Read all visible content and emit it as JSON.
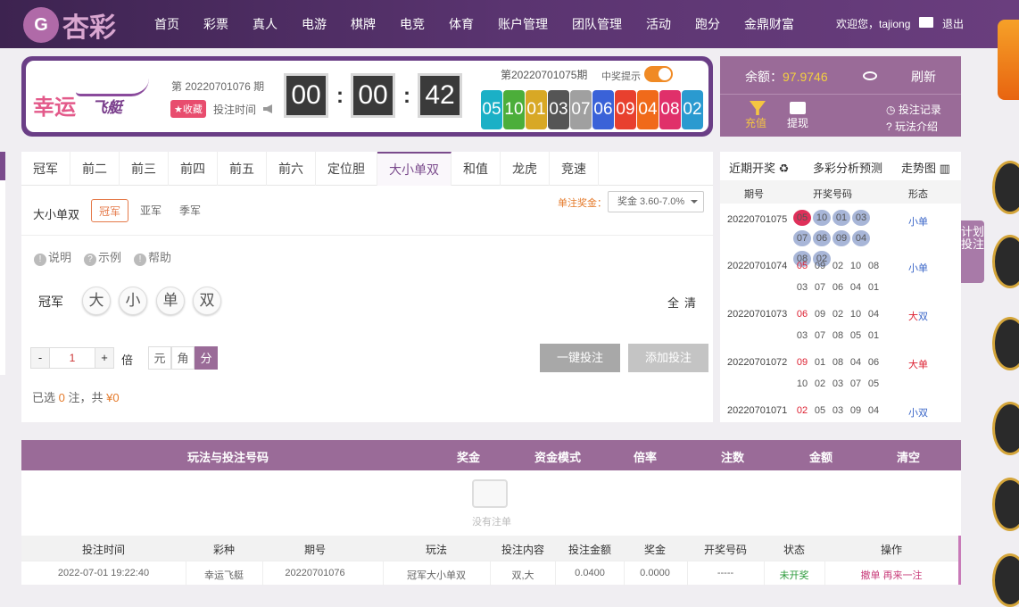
{
  "brand": {
    "name": "杏彩",
    "mark": "G"
  },
  "nav": [
    "首页",
    "彩票",
    "真人",
    "电游",
    "棋牌",
    "电竞",
    "体育",
    "账户管理",
    "团队管理",
    "活动",
    "跑分",
    "金鼎财富"
  ],
  "user": {
    "welcome": "欢迎您，tajiong",
    "logout": "退出"
  },
  "game": {
    "name_a": "幸运",
    "name_b": "飞艇",
    "issue": "第 20220701076 期",
    "fav": "★收藏",
    "bet_time_label": "投注时间",
    "countdown": [
      "00",
      "00",
      "42"
    ],
    "last_issue": "第20220701075期",
    "prize_tip": "中奖提示",
    "balls": [
      "05",
      "10",
      "01",
      "03",
      "07",
      "06",
      "09",
      "04",
      "08",
      "02"
    ],
    "ball_colors": [
      "#1bb0c6",
      "#4cae3a",
      "#d8a825",
      "#555555",
      "#a0a0a0",
      "#3a62d8",
      "#e8402e",
      "#f06a1a",
      "#e0306a",
      "#2a9ad0"
    ]
  },
  "account": {
    "balance_label": "余额：",
    "balance": "97.9746",
    "refresh": "刷新",
    "deposit": "充值",
    "withdraw": "提现",
    "bet_record": "投注记录",
    "rules": "玩法介绍"
  },
  "tabs": [
    "冠军",
    "前二",
    "前三",
    "前四",
    "前五",
    "前六",
    "定位胆",
    "大小单双",
    "和值",
    "龙虎",
    "竞速"
  ],
  "active_tab": "大小单双",
  "subplay": {
    "title": "大小单双",
    "options": [
      "冠军",
      "亚军",
      "季军"
    ],
    "bonus_label": "单注奖金：",
    "bonus_value": "奖金 3.60-7.0%"
  },
  "helps": [
    "说明",
    "示例",
    "帮助"
  ],
  "pick": {
    "label": "冠军",
    "options": [
      "大",
      "小",
      "单",
      "双"
    ],
    "all_clear": "全清"
  },
  "bet": {
    "multiplier": "1",
    "minus": "-",
    "plus": "+",
    "bei": "倍",
    "units": [
      "元",
      "角",
      "分"
    ],
    "active_unit": "分",
    "quick_bet": "一键投注",
    "add_bet": "添加投注",
    "summary_pre": "已选",
    "count": "0",
    "summary_mid": "注，共",
    "amount": "¥0"
  },
  "history": {
    "tabs": [
      "近期开奖",
      "多彩分析预测",
      "走势图"
    ],
    "headers": [
      "期号",
      "开奖号码",
      "形态"
    ],
    "rows": [
      {
        "issue": "20220701075",
        "nums": [
          "05",
          "10",
          "01",
          "03",
          "07",
          "06",
          "09",
          "04",
          "08",
          "02"
        ],
        "shape_a": "",
        "shape_b": "小单"
      },
      {
        "issue": "20220701074",
        "nums": [
          "05",
          "09",
          "02",
          "10",
          "08",
          "03",
          "07",
          "06",
          "04",
          "01"
        ],
        "shape_a": "",
        "shape_b": "小单"
      },
      {
        "issue": "20220701073",
        "nums": [
          "06",
          "09",
          "02",
          "10",
          "04",
          "03",
          "07",
          "08",
          "05",
          "01"
        ],
        "shape_a": "大",
        "shape_b": "双"
      },
      {
        "issue": "20220701072",
        "nums": [
          "09",
          "01",
          "08",
          "04",
          "06",
          "10",
          "02",
          "03",
          "07",
          "05"
        ],
        "shape_a": "大单",
        "shape_b": ""
      },
      {
        "issue": "20220701071",
        "nums": [
          "02",
          "05",
          "03",
          "09",
          "04"
        ],
        "shape_a": "",
        "shape_b": "小双"
      }
    ]
  },
  "plan": "计划投注",
  "betlist": {
    "headers": [
      "玩法与投注号码",
      "奖金",
      "资金模式",
      "倍率",
      "注数",
      "金额",
      "清空"
    ],
    "empty": "没有注单"
  },
  "records": {
    "headers": [
      "投注时间",
      "彩种",
      "期号",
      "玩法",
      "投注内容",
      "投注金额",
      "奖金",
      "开奖号码",
      "状态",
      "操作"
    ],
    "row": [
      "2022-07-01 19:22:40",
      "幸运飞艇",
      "20220701076",
      "冠军大小单双",
      "双,大",
      "0.0400",
      "0.0000",
      "-----",
      "未开奖",
      "撤单 再来一注"
    ]
  }
}
